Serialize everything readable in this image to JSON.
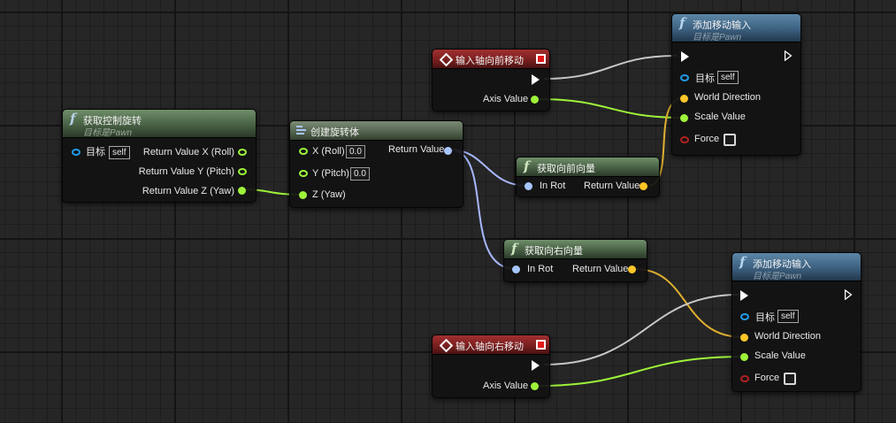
{
  "colors": {
    "exec": "#ffffff",
    "object": "#1e9be8",
    "float": "#9ef23a",
    "vector": "#ffc727",
    "rotator": "#a7c6ff",
    "bool": "#b02121",
    "wire_exec": "#c8c8c8",
    "wire_float": "#9ef23a",
    "wire_vector": "#e0b030",
    "wire_rotator": "#a8b8ff"
  },
  "nodes": {
    "get_control_rotation": {
      "title": "获取控制旋转",
      "subtitle": "目标是Pawn",
      "target_label": "目标",
      "target_default": "self",
      "out_x": "Return Value X (Roll)",
      "out_y": "Return Value Y (Pitch)",
      "out_z": "Return Value Z (Yaw)"
    },
    "make_rotator": {
      "title": "创建旋转体",
      "x_label": "X (Roll)",
      "x_value": "0.0",
      "y_label": "Y (Pitch)",
      "y_value": "0.0",
      "z_label": "Z (Yaw)",
      "return_label": "Return Value"
    },
    "input_axis_forward": {
      "title": "输入轴向前移动",
      "axis_label": "Axis Value"
    },
    "get_forward_vector": {
      "title": "获取向前向量",
      "in_label": "In Rot",
      "return_label": "Return Value"
    },
    "get_right_vector": {
      "title": "获取向右向量",
      "in_label": "In Rot",
      "return_label": "Return Value"
    },
    "input_axis_right": {
      "title": "输入轴向右移动",
      "axis_label": "Axis Value"
    },
    "add_movement_1": {
      "title": "添加移动输入",
      "subtitle": "目标是Pawn",
      "target_label": "目标",
      "target_default": "self",
      "world_direction": "World Direction",
      "scale_value": "Scale Value",
      "force": "Force",
      "force_checked": false
    },
    "add_movement_2": {
      "title": "添加移动输入",
      "subtitle": "目标是Pawn",
      "target_label": "目标",
      "target_default": "self",
      "world_direction": "World Direction",
      "scale_value": "Scale Value",
      "force": "Force",
      "force_checked": false
    }
  }
}
